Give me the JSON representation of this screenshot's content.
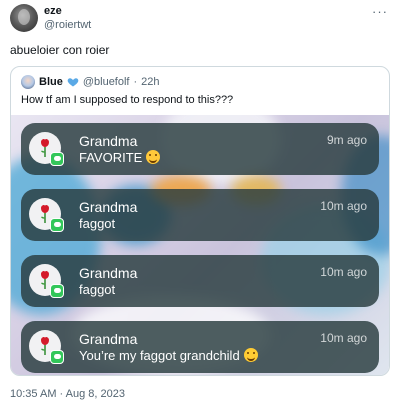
{
  "tweet": {
    "author": {
      "display_name": "eze",
      "handle": "@roiertwt"
    },
    "more_icon": "more-dots-icon",
    "text": "abueloier con roier",
    "timestamp": "10:35 AM · Aug 8, 2023"
  },
  "quote": {
    "author": {
      "display_name": "Blue",
      "handle": "@bluefolf",
      "time": "22h",
      "dot": "·"
    },
    "badge_icon": "blue-heart-icon",
    "badge_color": "#5aa9e6",
    "text": "How tf am I supposed to respond to this???",
    "notifications": [
      {
        "sender": "Grandma",
        "message": "FAVORITE",
        "emoji": "star-struck-emoji",
        "time": "9m ago"
      },
      {
        "sender": "Grandma",
        "message": "faggot",
        "emoji": "",
        "time": "10m ago"
      },
      {
        "sender": "Grandma",
        "message": "faggot",
        "emoji": "",
        "time": "10m ago"
      },
      {
        "sender": "Grandma",
        "message": "You’re my faggot grandchild",
        "emoji": "smiling-face-emoji",
        "time": "10m ago"
      }
    ],
    "notification_icon": "rose-icon",
    "app_badge_icon": "messages-icon",
    "app_badge_color": "#33c75a"
  }
}
